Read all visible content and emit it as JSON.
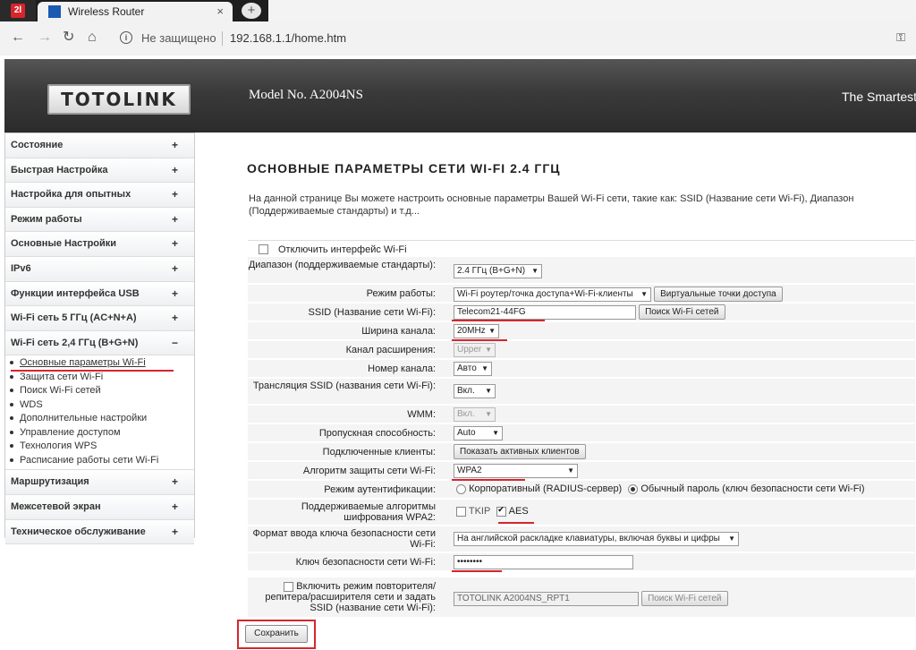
{
  "browser": {
    "pinned_tab_icon": "2l",
    "tab_title": "Wireless Router",
    "tab_close": "×",
    "new_tab": "+",
    "security_label": "Не защищено",
    "url": "192.168.1.1/home.htm"
  },
  "header": {
    "logo": "TOTOLINK",
    "model": "Model No. A2004NS",
    "slogan": "The Smartest"
  },
  "sidebar": {
    "items_top": [
      {
        "label": "Состояние",
        "sign": "+"
      },
      {
        "label": "Быстрая Настройка",
        "sign": "+"
      },
      {
        "label": "Настройка для опытных",
        "sign": "+"
      },
      {
        "label": "Режим работы",
        "sign": "+"
      },
      {
        "label": "Основные Настройки",
        "sign": "+"
      },
      {
        "label": "IPv6",
        "sign": "+"
      },
      {
        "label": "Функции интерфейса USB",
        "sign": "+"
      },
      {
        "label": "Wi-Fi сеть 5 ГГц (AC+N+A)",
        "sign": "+"
      },
      {
        "label": "Wi-Fi сеть 2,4 ГГц (B+G+N)",
        "sign": "−"
      }
    ],
    "sub_items": [
      "Основные параметры Wi-Fi",
      "Защита сети Wi-Fi",
      "Поиск Wi-Fi сетей",
      "WDS",
      "Дополнительные настройки",
      "Управление доступом",
      "Технология WPS",
      "Расписание работы сети Wi-Fi"
    ],
    "items_bottom": [
      {
        "label": "Маршрутизация",
        "sign": "+"
      },
      {
        "label": "Межсетевой экран",
        "sign": "+"
      },
      {
        "label": "Техническое обслуживание",
        "sign": "+"
      }
    ]
  },
  "content": {
    "title": "ОСНОВНЫЕ ПАРАМЕТРЫ СЕТИ WI-FI 2.4 ГГЦ",
    "description": "На данной странице Вы можете настроить основные параметры Вашей Wi-Fi сети, такие как: SSID (Название сети Wi-Fi), Диапазон (Поддерживаемые стандарты) и т.д...",
    "disable_wifi": "Отключить интерфейс Wi-Fi",
    "band_label": "Диапазон (поддерживаемые стандарты):",
    "band_value": "2.4 ГГц (B+G+N)",
    "mode_label": "Режим работы:",
    "mode_value": "Wi-Fi роутер/точка доступа+Wi-Fi-клиенты",
    "virtual_ap_button": "Виртуальные точки доступа",
    "ssid_label": "SSID (Название сети Wi-Fi):",
    "ssid_value": "Telecom21-44FG",
    "scan_button": "Поиск Wi-Fi сетей",
    "width_label": "Ширина канала:",
    "width_value": "20MHz",
    "ext_label": "Канал расширения:",
    "ext_value": "Upper",
    "channel_label": "Номер канала:",
    "channel_value": "Авто",
    "broadcast_label": "Трансляция SSID (названия сети Wi-Fi):",
    "broadcast_value": "Вкл.",
    "wmm_label": "WMM:",
    "wmm_value": "Вкл.",
    "rate_label": "Пропускная способность:",
    "rate_value": "Auto",
    "clients_label": "Подключенные клиенты:",
    "clients_button": "Показать активных клиентов",
    "enc_label": "Алгоритм защиты сети Wi-Fi:",
    "enc_value": "WPA2",
    "auth_label": "Режим аутентификации:",
    "auth_enterprise": "Корпоративный (RADIUS-сервер)",
    "auth_personal": "Обычный пароль (ключ безопасности сети Wi-Fi)",
    "cipher_label": "Поддерживаемые алгоритмы шифрования WPA2:",
    "cipher_tkip": "TKIP",
    "cipher_aes": "AES",
    "keyfmt_label": "Формат ввода ключа безопасности сети Wi-Fi:",
    "keyfmt_value": "На английской раскладке клавиатуры, включая буквы и цифры",
    "key_label": "Ключ безопасности сети Wi-Fi:",
    "key_value": "••••••••",
    "repeater_label": "Включить режим повторителя/репитера/расширителя сети и задать SSID (название сети Wi-Fi):",
    "repeater_ssid": "TOTOLINK A2004NS_RPT1",
    "repeater_scan_button": "Поиск Wi-Fi сетей",
    "save_button": "Сохранить"
  }
}
